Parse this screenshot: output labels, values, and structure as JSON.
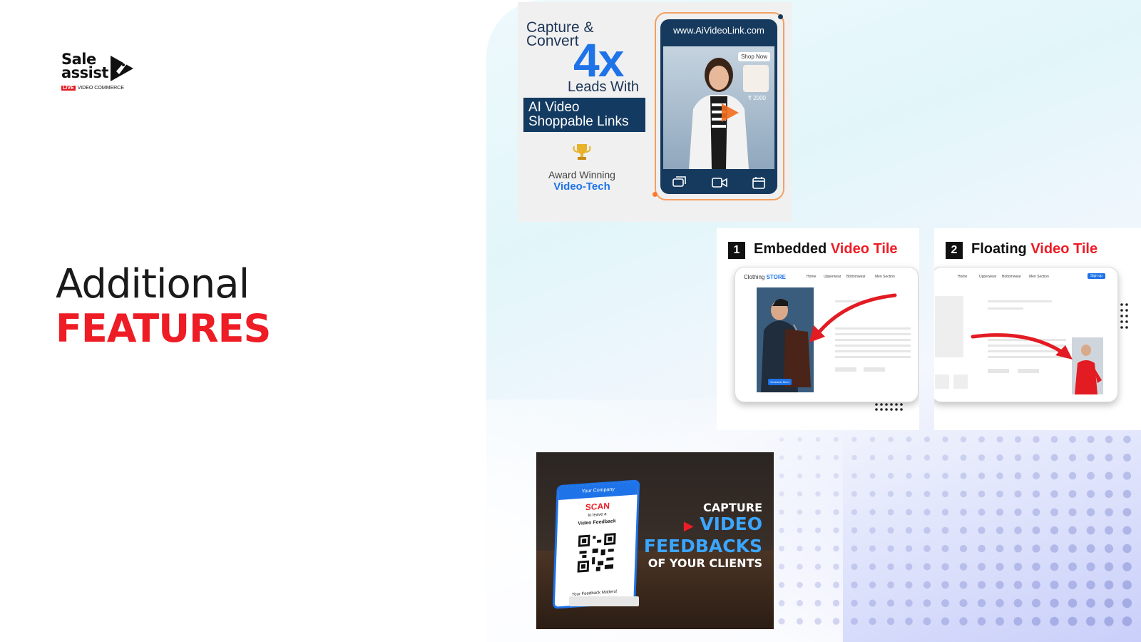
{
  "logo": {
    "line1": "Sale",
    "line2": "assist",
    "live": "LIVE",
    "tagline": "VIDEO COMMERCE"
  },
  "heading": {
    "line1": "Additional",
    "line2": "FEATURES"
  },
  "card_ai_links": {
    "capture": "Capture &",
    "convert": "Convert",
    "multiplier": "4x",
    "leads_with": "Leads With",
    "box_line1": "AI Video",
    "box_line2": "Shoppable Links",
    "award": "Award Winning",
    "video_tech": "Video-Tech",
    "url": "www.AiVideoLink.com",
    "shop_now": "Shop Now",
    "price": "₹ 2000"
  },
  "card_embedded": {
    "number": "1",
    "title": "Embedded",
    "title_highlight": "Video Tile",
    "store_name": "Clothing",
    "store_suffix": "STORE",
    "nav": [
      "Home",
      "Upperwear",
      "Bottomwear",
      "Men Section"
    ],
    "cta": "Schedule Meet"
  },
  "card_floating": {
    "number": "2",
    "title": "Floating",
    "title_highlight": "Video Tile",
    "nav": [
      "Home",
      "Upperwear",
      "Bottomwear",
      "Men Section"
    ],
    "signup": "Sign up"
  },
  "card_feedback": {
    "company": "Your Company",
    "scan": "SCAN",
    "leave": "to leave a",
    "video_feedback": "Video Feedback",
    "footer": "Your Feedback Matters!",
    "capture": "CAPTURE",
    "video": "VIDEO",
    "feedbacks": "FEEDBACKS",
    "of_clients": "OF YOUR CLIENTS"
  },
  "colors": {
    "brand_red": "#ee1c25",
    "brand_blue": "#1e73e8",
    "navy": "#133a61"
  }
}
